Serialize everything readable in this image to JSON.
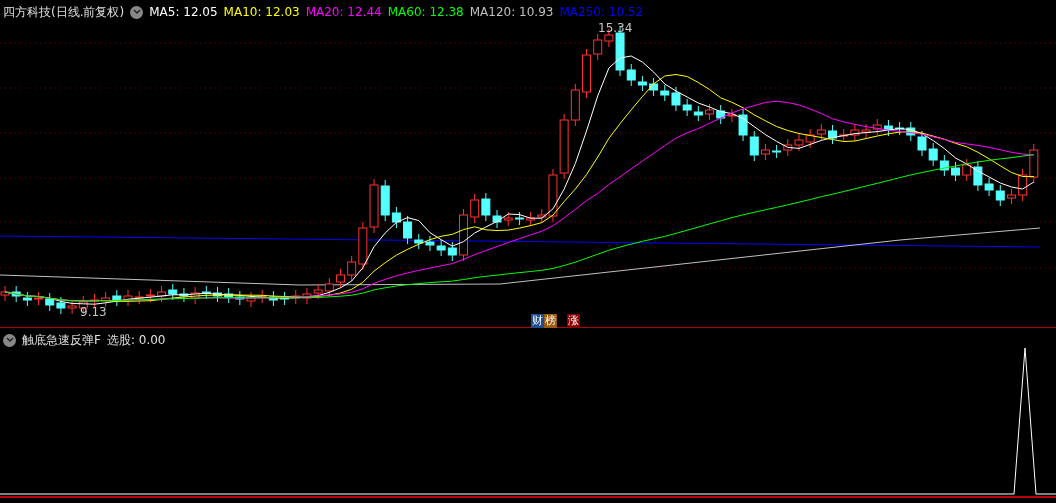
{
  "title": "四方科技(日线.前复权)",
  "legend": [
    {
      "label": "MA5: 12.05",
      "color": "#ffffff"
    },
    {
      "label": "MA10: 12.03",
      "color": "#ffff00"
    },
    {
      "label": "MA20: 12.44",
      "color": "#ff00ff"
    },
    {
      "label": "MA60: 12.38",
      "color": "#00ff00"
    },
    {
      "label": "MA120: 10.93",
      "color": "#c0c0c0"
    },
    {
      "label": "MA250: 10.52",
      "color": "#0000ff"
    }
  ],
  "high_label": "15.34",
  "low_label": "9.13",
  "markers": [
    {
      "label": "财",
      "color": "#1f4e8c"
    },
    {
      "label": "榜",
      "color": "#9a5a10"
    },
    {
      "label": "涨",
      "color": "#8b0000"
    }
  ],
  "indicator": {
    "title": "触底急速反弹F",
    "reading": "选股: 0.00"
  }
}
